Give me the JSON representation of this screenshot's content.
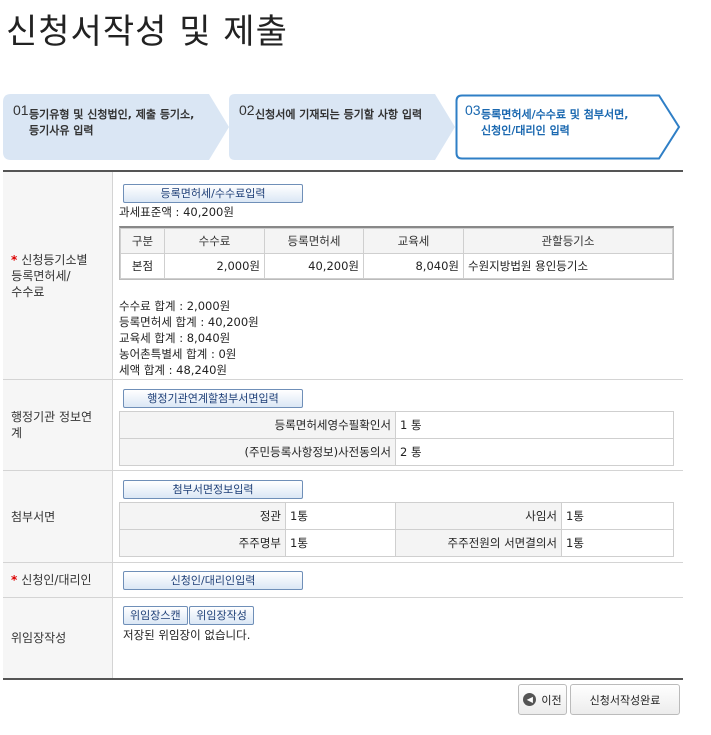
{
  "page_title": "신청서작성 및 제출",
  "steps": [
    {
      "num": "01",
      "line1": "등기유형 및 신청법인, 제출 등기소,",
      "line2": "등기사유 입력"
    },
    {
      "num": "02",
      "line1": "신청서에 기재되는 등기할 사항 입력",
      "line2": ""
    },
    {
      "num": "03",
      "line1": "등록면허세/수수료 및 첨부서면,",
      "line2": "신청인/대리인 입력"
    }
  ],
  "fee_section": {
    "label_line1": "신청등기소별",
    "label_line2": "등록면허세/",
    "label_line3": "수수료",
    "button": "등록면허세/수수료입력",
    "tax_base": "과세표준액 : 40,200원",
    "table_headers": [
      "구분",
      "수수료",
      "등록면허세",
      "교육세",
      "관할등기소"
    ],
    "table_rows": [
      [
        "본점",
        "2,000원",
        "40,200원",
        "8,040원",
        "수원지방법원 용인등기소"
      ]
    ],
    "summary": [
      "수수료 합계 : 2,000원",
      "등록면허세 합계 : 40,200원",
      "교육세 합계 : 8,040원",
      "농어촌특별세 합계 : 0원",
      "세액 합계 : 48,240원"
    ]
  },
  "admin_section": {
    "label_line1": "행정기관 정보연",
    "label_line2": "계",
    "button": "행정기관연계할첨부서면입력",
    "items": [
      {
        "name": "등록면허세영수필확인서",
        "count": "1 통"
      },
      {
        "name": "(주민등록사항정보)사전동의서",
        "count": "2 통"
      }
    ]
  },
  "attach_section": {
    "label": "첨부서면",
    "button": "첨부서면정보입력",
    "rows": [
      [
        {
          "name": "정관",
          "count": "1통"
        },
        {
          "name": "사임서",
          "count": "1통"
        }
      ],
      [
        {
          "name": "주주명부",
          "count": "1통"
        },
        {
          "name": "주주전원의 서면결의서",
          "count": "1통"
        }
      ]
    ]
  },
  "applicant_section": {
    "label": "신청인/대리인",
    "button": "신청인/대리인입력"
  },
  "proxy_section": {
    "label": "위임장작성",
    "scan_button": "위임장스캔",
    "write_button": "위임장작성",
    "message": "저장된 위임장이 없습니다."
  },
  "footer": {
    "prev": "이전",
    "complete": "신청서작성완료"
  },
  "colors": {
    "step_inactive": "#dae6f4",
    "step_active_border": "#2f7fc6",
    "required": "#dd0000"
  }
}
